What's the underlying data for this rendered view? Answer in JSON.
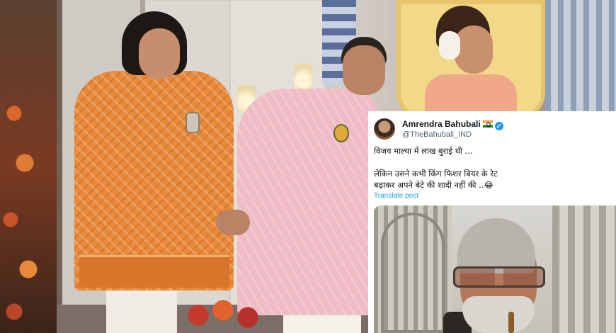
{
  "tweet": {
    "author_name": "Amrendra Bahubali",
    "author_handle": "@TheBahubali_IND",
    "flag_icon": "india-flag-icon",
    "verified_icon": "verified-badge-icon",
    "text_line1": "विजय माल्या में लाख बुराई थी ...",
    "text_line2": "लेकिन उसने कभी किंग फिशर बियर के रेट",
    "text_line3": "बढ़ाकर अपने बेटे की शादी नहीं की ..😂",
    "translate_label": "Translate post"
  },
  "colors": {
    "verified": "#1d9bf0",
    "link": "#1d9bf0",
    "handle": "#536471",
    "text": "#0f1419"
  }
}
